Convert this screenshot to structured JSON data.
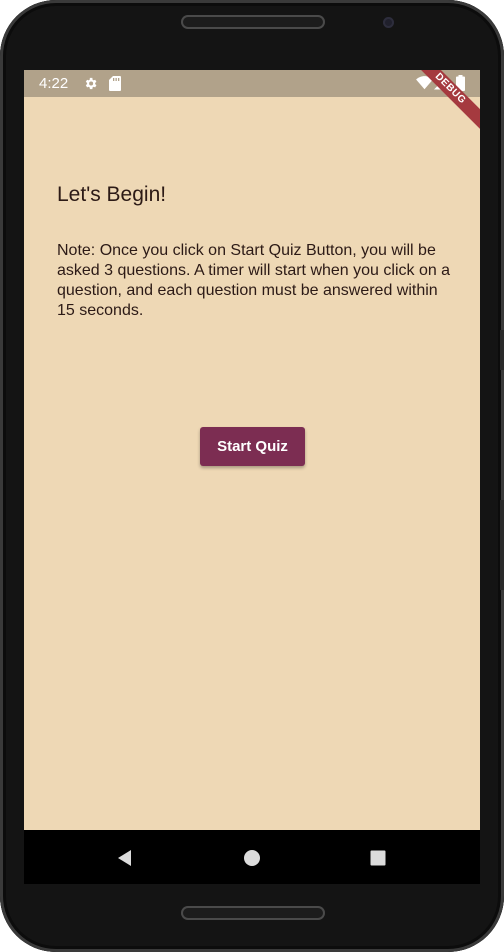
{
  "status_bar": {
    "time": "4:22",
    "icons": [
      "gear-icon",
      "sd-card-icon",
      "wifi-icon",
      "signal-icon",
      "battery-icon"
    ],
    "debug_label": "DEBUG"
  },
  "content": {
    "heading": "Let's Begin!",
    "note": "Note: Once you click on Start Quiz Button, you will be asked 3 questions. A timer will start when you click on a question, and each question must be answered within 15 seconds.",
    "start_button_label": "Start Quiz"
  },
  "navigation": {
    "buttons": [
      "back-icon",
      "home-icon",
      "recents-icon"
    ]
  },
  "colors": {
    "background": "#eed8b5",
    "status_bar": "#b1a28a",
    "button": "#7c2d52",
    "text": "#2c1a16"
  }
}
